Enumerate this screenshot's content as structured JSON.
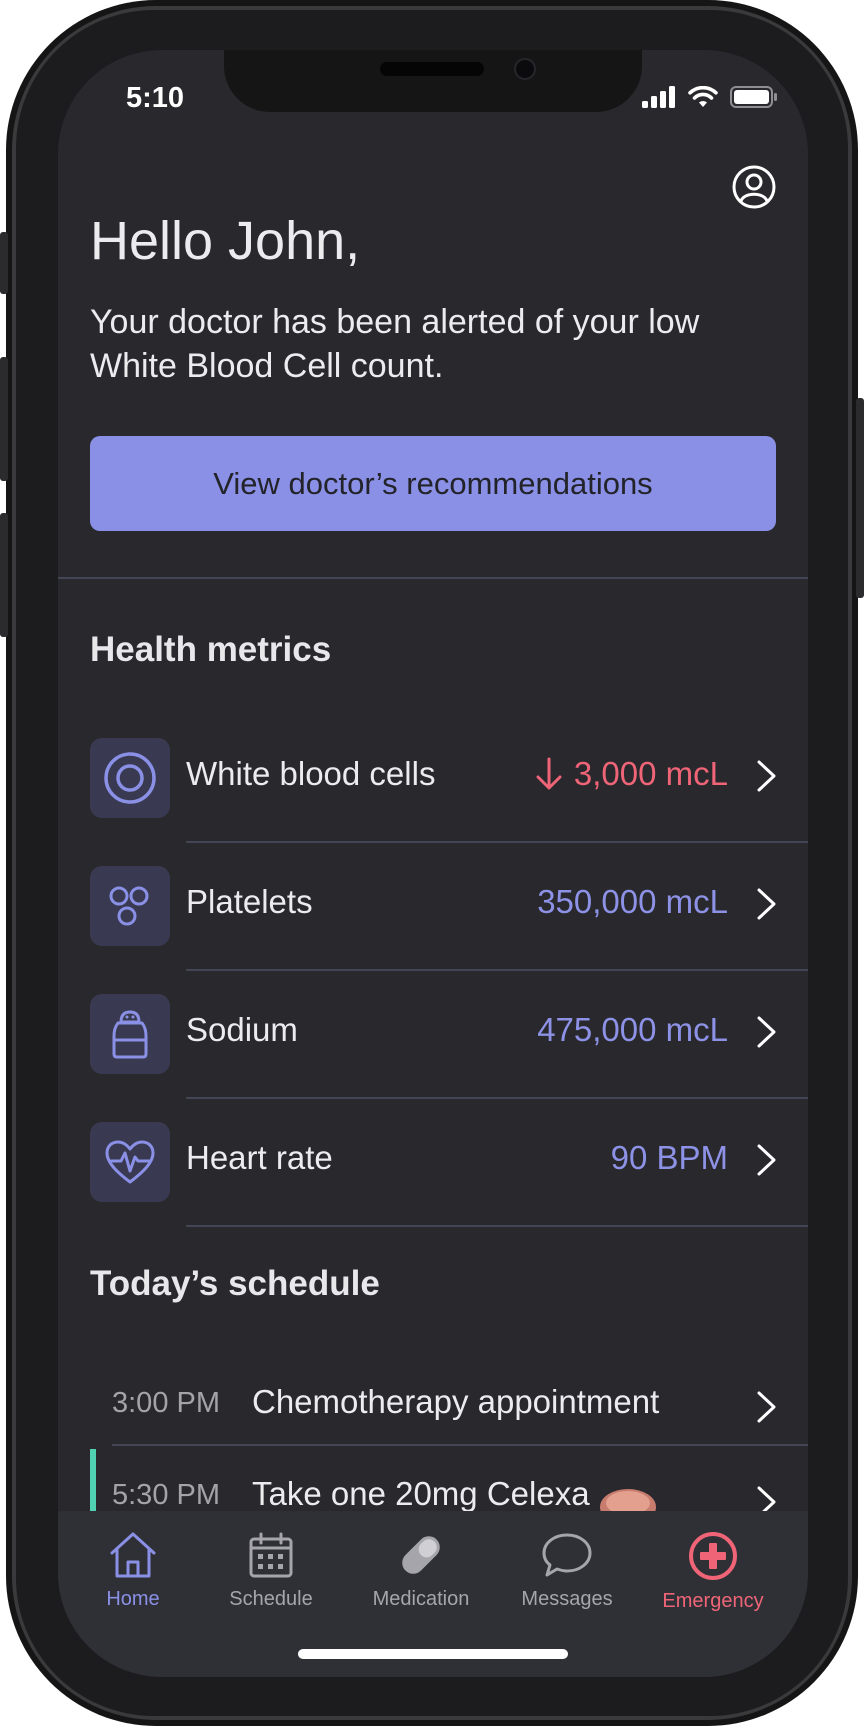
{
  "status_bar": {
    "time": "5:10"
  },
  "header": {
    "greeting": "Hello John,",
    "alert_message": "Your doctor has been alerted of your low White Blood Cell count.",
    "cta_label": "View doctor’s recommendations"
  },
  "health_metrics": {
    "title": "Health metrics",
    "items": [
      {
        "label": "White blood cells",
        "value": "3,000 mcL",
        "trend": "down",
        "icon": "target-icon"
      },
      {
        "label": "Platelets",
        "value": "350,000 mcL",
        "icon": "platelets-icon"
      },
      {
        "label": "Sodium",
        "value": "475,000 mcL",
        "icon": "salt-shaker-icon"
      },
      {
        "label": "Heart rate",
        "value": "90 BPM",
        "icon": "heartbeat-icon"
      }
    ]
  },
  "schedule": {
    "title": "Today’s schedule",
    "items": [
      {
        "time": "3:00 PM",
        "title": "Chemotherapy appointment"
      },
      {
        "time": "5:30 PM",
        "title": "Take one 20mg Celexa"
      }
    ]
  },
  "tabbar": {
    "items": [
      {
        "label": "Home",
        "icon": "home-icon",
        "active": true
      },
      {
        "label": "Schedule",
        "icon": "calendar-icon"
      },
      {
        "label": "Medication",
        "icon": "pill-icon"
      },
      {
        "label": "Messages",
        "icon": "chat-bubble-icon"
      },
      {
        "label": "Emergency",
        "icon": "emergency-cross-icon"
      }
    ]
  },
  "colors": {
    "background": "#28282d",
    "accent": "#8a90e6",
    "alert": "#ef6577",
    "schedule_marker": "#4fd1b2"
  }
}
